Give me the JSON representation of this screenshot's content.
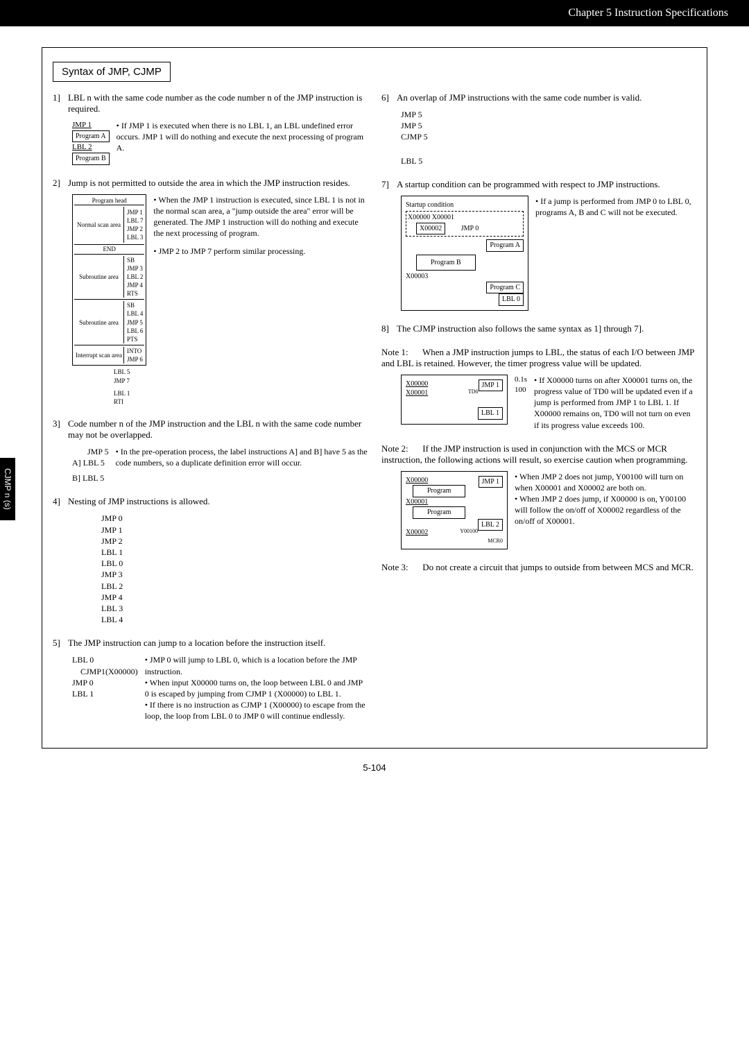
{
  "header": {
    "chapter": "Chapter 5   Instruction Specifications"
  },
  "sidetab": "CJMP n (s)",
  "syntax_title": "Syntax of JMP, CJMP",
  "left": {
    "i1": {
      "num": "1]",
      "text": "LBL n with the same code number as the code number n of the JMP instruction is required.",
      "d": {
        "jmp1": "JMP 1",
        "pa": "Program A",
        "lbl2": "LBL 2",
        "pb": "Program B"
      },
      "bullet": "If JMP 1 is executed when there is no LBL 1, an LBL undefined error occurs. JMP 1 will do nothing and execute the next processing of program A."
    },
    "i2": {
      "num": "2]",
      "text": "Jump is not permitted to outside the area in which the JMP instruction resides.",
      "d": {
        "ph": "Program head",
        "nsa": "Normal scan area",
        "s1": "JMP 1\nLBL 7\nJMP 2\nLBL 3",
        "end": "END",
        "sa1": "Subroutine area",
        "s2": "SB\nJMP 3\nLBL 2\nJMP 4\nRTS",
        "sa2": "Subroutine area",
        "s3": "SB\nLBL 4\nJMP 5\nLBL 6\nPTS",
        "isa": "Interrupt scan area",
        "s4": "INTO\nJMP 6",
        "s5": "LBL 5\nJMP 7",
        "s6": "LBL 1\nRTI"
      },
      "b1": "When the JMP 1 instruction is executed, since LBL 1 is not in the normal scan area, a \"jump outside the area\" error will be generated. The JMP 1 instruction will do nothing and execute the next processing of program.",
      "b2": "JMP 2 to JMP 7 perform similar processing."
    },
    "i3": {
      "num": "3]",
      "text": "Code number n of the JMP instruction and the LBL n with the same code number may not be overlapped.",
      "d": {
        "jmp5": "JMP 5",
        "a": "A]  LBL 5",
        "b": "B]  LBL 5"
      },
      "bullet": "In the pre-operation process, the label instructions A] and B] have 5 as the code numbers, so a duplicate definition error will occur."
    },
    "i4": {
      "num": "4]",
      "text": "Nesting of JMP instructions is allowed.",
      "d": "JMP 0\nJMP 1\nJMP 2\nLBL 1\nLBL 0\nJMP 3\nLBL 2\nJMP 4\nLBL 3\nLBL 4"
    },
    "i5": {
      "num": "5]",
      "text": "The JMP instruction can jump to a location before the instruction itself.",
      "d": {
        "l0": "LBL 0",
        "cj": "CJMP1(X00000)",
        "j0": "JMP 0",
        "l1": "LBL 1"
      },
      "b1": "JMP 0 will jump to LBL 0, which is a location before the JMP instruction.",
      "b2": "When input X00000 turns on, the loop between LBL 0 and JMP 0 is escaped by jumping from CJMP 1  (X00000) to LBL 1.",
      "b3": "If there is no instruction as CJMP 1 (X00000) to escape from the loop, the loop from LBL 0 to JMP 0 will continue endlessly."
    }
  },
  "right": {
    "i6": {
      "num": "6]",
      "text": "An overlap of JMP instructions with the same code number is valid.",
      "d": {
        "j5a": "JMP 5",
        "j5b": "JMP 5",
        "cj5": "CJMP 5",
        "l5": "LBL 5"
      }
    },
    "i7": {
      "num": "7]",
      "text": "A startup condition can be programmed with respect to JMP instructions.",
      "d": {
        "sc": "Startup condition",
        "x0": "X00000 X00001",
        "x2": "X00002",
        "jmp0": "JMP 0",
        "pa": "Program A",
        "pb": "Program B",
        "x3": "X00003",
        "pc": "Program C",
        "l0": "LBL 0"
      },
      "bullet": "If a jump is performed from JMP 0 to LBL 0, programs A, B and C will not be executed."
    },
    "i8": {
      "num": "8]",
      "text": "The CJMP instruction also follows the same syntax as 1] through 7]."
    },
    "n1": {
      "label": "Note 1:",
      "text": "When a JMP instruction jumps to LBL, the status of each I/O between JMP and LBL is retained. However, the timer progress value will be updated.",
      "d": {
        "x0": "X00000",
        "jmp1": "JMP 1",
        "x1": "X00001",
        "td0": "TD0",
        "t": "0.1s\n100",
        "lbl1": "LBL 1"
      },
      "bullet": "If X00000 turns on after X00001 turns on, the progress value of TD0 will be updated even if a jump is performed from JMP 1 to LBL 1. If X00000 remains on, TD0 will not turn on even if its progress value exceeds 100."
    },
    "n2": {
      "label": "Note 2:",
      "text": "If the JMP instruction is used in conjunction with the MCS or MCR instruction, the following actions will result, so exercise caution when programming.",
      "d": {
        "x0": "X00000",
        "jmp1": "JMP 1",
        "prog1": "Program",
        "x1": "X00001",
        "prog2": "Program",
        "lbl2": "LBL 2",
        "y": "Y00100",
        "x2": "X00002",
        "mcr0": "MCR0"
      },
      "b1": "When JMP 2 does not jump, Y00100 will turn on when X00001 and X00002 are both on.",
      "b2": "When JMP 2 does jump, if X00000 is on, Y00100 will follow the on/off of X00002 regardless of the on/off of X00001."
    },
    "n3": {
      "label": "Note 3:",
      "text": "Do not create a circuit that jumps to outside from between MCS and MCR."
    }
  },
  "pagenum": "5-104"
}
